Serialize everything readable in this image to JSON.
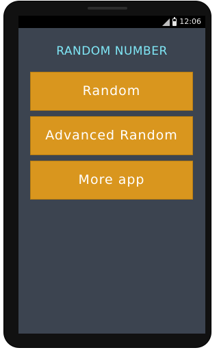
{
  "status_bar": {
    "time": "12:06",
    "icons": [
      "signal-icon",
      "battery-charging-icon"
    ]
  },
  "app": {
    "title": "RANDOM NUMBER",
    "buttons": [
      {
        "label": "Random"
      },
      {
        "label": "Advanced Random"
      },
      {
        "label": "More app"
      }
    ]
  },
  "colors": {
    "background": "#3c4450",
    "title": "#7fe6f5",
    "button": "#d9961e",
    "button_text": "#ffffff"
  }
}
